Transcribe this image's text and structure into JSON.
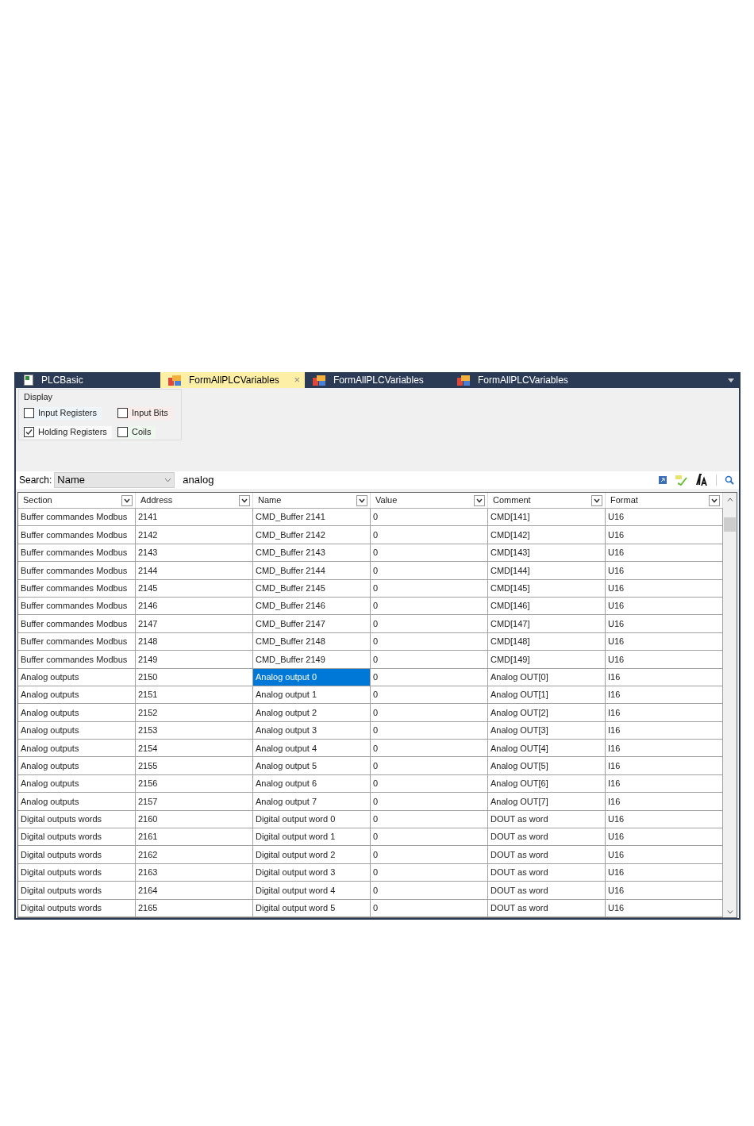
{
  "tabs": [
    {
      "label": "PLCBasic",
      "selected": false,
      "kind": "sheet"
    },
    {
      "label": "FormAllPLCVariables",
      "selected": true,
      "kind": "form",
      "close": "×"
    },
    {
      "label": "FormAllPLCVariables",
      "selected": false,
      "kind": "form"
    },
    {
      "label": "FormAllPLCVariables",
      "selected": false,
      "kind": "form"
    }
  ],
  "display": {
    "title": "Display",
    "options": [
      {
        "label": "Input Registers",
        "checked": false,
        "color": "#eef5fb"
      },
      {
        "label": "Input Bits",
        "checked": false,
        "color": "#fbecec"
      },
      {
        "label": "Holding Registers",
        "checked": true,
        "color": "#fafafa"
      },
      {
        "label": "Coils",
        "checked": false,
        "color": "#eef8ee"
      }
    ]
  },
  "search": {
    "label": "Search:",
    "field": "Name",
    "value": "analog"
  },
  "table": {
    "columns": [
      "Section",
      "Address",
      "Name",
      "Value",
      "Comment",
      "Format"
    ],
    "rows": [
      {
        "cells": [
          "Buffer commandes Modbus",
          "2141",
          "CMD_Buffer 2141",
          "0",
          "CMD[141]",
          "U16"
        ],
        "selected": false
      },
      {
        "cells": [
          "Buffer commandes Modbus",
          "2142",
          "CMD_Buffer 2142",
          "0",
          "CMD[142]",
          "U16"
        ],
        "selected": false
      },
      {
        "cells": [
          "Buffer commandes Modbus",
          "2143",
          "CMD_Buffer 2143",
          "0",
          "CMD[143]",
          "U16"
        ],
        "selected": false
      },
      {
        "cells": [
          "Buffer commandes Modbus",
          "2144",
          "CMD_Buffer 2144",
          "0",
          "CMD[144]",
          "U16"
        ],
        "selected": false
      },
      {
        "cells": [
          "Buffer commandes Modbus",
          "2145",
          "CMD_Buffer 2145",
          "0",
          "CMD[145]",
          "U16"
        ],
        "selected": false
      },
      {
        "cells": [
          "Buffer commandes Modbus",
          "2146",
          "CMD_Buffer 2146",
          "0",
          "CMD[146]",
          "U16"
        ],
        "selected": false
      },
      {
        "cells": [
          "Buffer commandes Modbus",
          "2147",
          "CMD_Buffer 2147",
          "0",
          "CMD[147]",
          "U16"
        ],
        "selected": false
      },
      {
        "cells": [
          "Buffer commandes Modbus",
          "2148",
          "CMD_Buffer 2148",
          "0",
          "CMD[148]",
          "U16"
        ],
        "selected": false
      },
      {
        "cells": [
          "Buffer commandes Modbus",
          "2149",
          "CMD_Buffer 2149",
          "0",
          "CMD[149]",
          "U16"
        ],
        "selected": false
      },
      {
        "cells": [
          "Analog outputs",
          "2150",
          "Analog output 0",
          "0",
          "Analog OUT[0]",
          "I16"
        ],
        "selected": true
      },
      {
        "cells": [
          "Analog outputs",
          "2151",
          "Analog output 1",
          "0",
          "Analog OUT[1]",
          "I16"
        ],
        "selected": false
      },
      {
        "cells": [
          "Analog outputs",
          "2152",
          "Analog output 2",
          "0",
          "Analog OUT[2]",
          "I16"
        ],
        "selected": false
      },
      {
        "cells": [
          "Analog outputs",
          "2153",
          "Analog output 3",
          "0",
          "Analog OUT[3]",
          "I16"
        ],
        "selected": false
      },
      {
        "cells": [
          "Analog outputs",
          "2154",
          "Analog output 4",
          "0",
          "Analog OUT[4]",
          "I16"
        ],
        "selected": false
      },
      {
        "cells": [
          "Analog outputs",
          "2155",
          "Analog output 5",
          "0",
          "Analog OUT[5]",
          "I16"
        ],
        "selected": false
      },
      {
        "cells": [
          "Analog outputs",
          "2156",
          "Analog output 6",
          "0",
          "Analog OUT[6]",
          "I16"
        ],
        "selected": false
      },
      {
        "cells": [
          "Analog outputs",
          "2157",
          "Analog output 7",
          "0",
          "Analog OUT[7]",
          "I16"
        ],
        "selected": false
      },
      {
        "cells": [
          "Digital outputs words",
          "2160",
          "Digital output word 0",
          "0",
          "DOUT as word",
          "U16"
        ],
        "selected": false
      },
      {
        "cells": [
          "Digital outputs words",
          "2161",
          "Digital output word 1",
          "0",
          "DOUT as word",
          "U16"
        ],
        "selected": false
      },
      {
        "cells": [
          "Digital outputs words",
          "2162",
          "Digital output word 2",
          "0",
          "DOUT as word",
          "U16"
        ],
        "selected": false
      },
      {
        "cells": [
          "Digital outputs words",
          "2163",
          "Digital output word 3",
          "0",
          "DOUT as word",
          "U16"
        ],
        "selected": false
      },
      {
        "cells": [
          "Digital outputs words",
          "2164",
          "Digital output word 4",
          "0",
          "DOUT as word",
          "U16"
        ],
        "selected": false
      },
      {
        "cells": [
          "Digital outputs words",
          "2165",
          "Digital output word 5",
          "0",
          "DOUT as word",
          "U16"
        ],
        "selected": false
      }
    ]
  }
}
